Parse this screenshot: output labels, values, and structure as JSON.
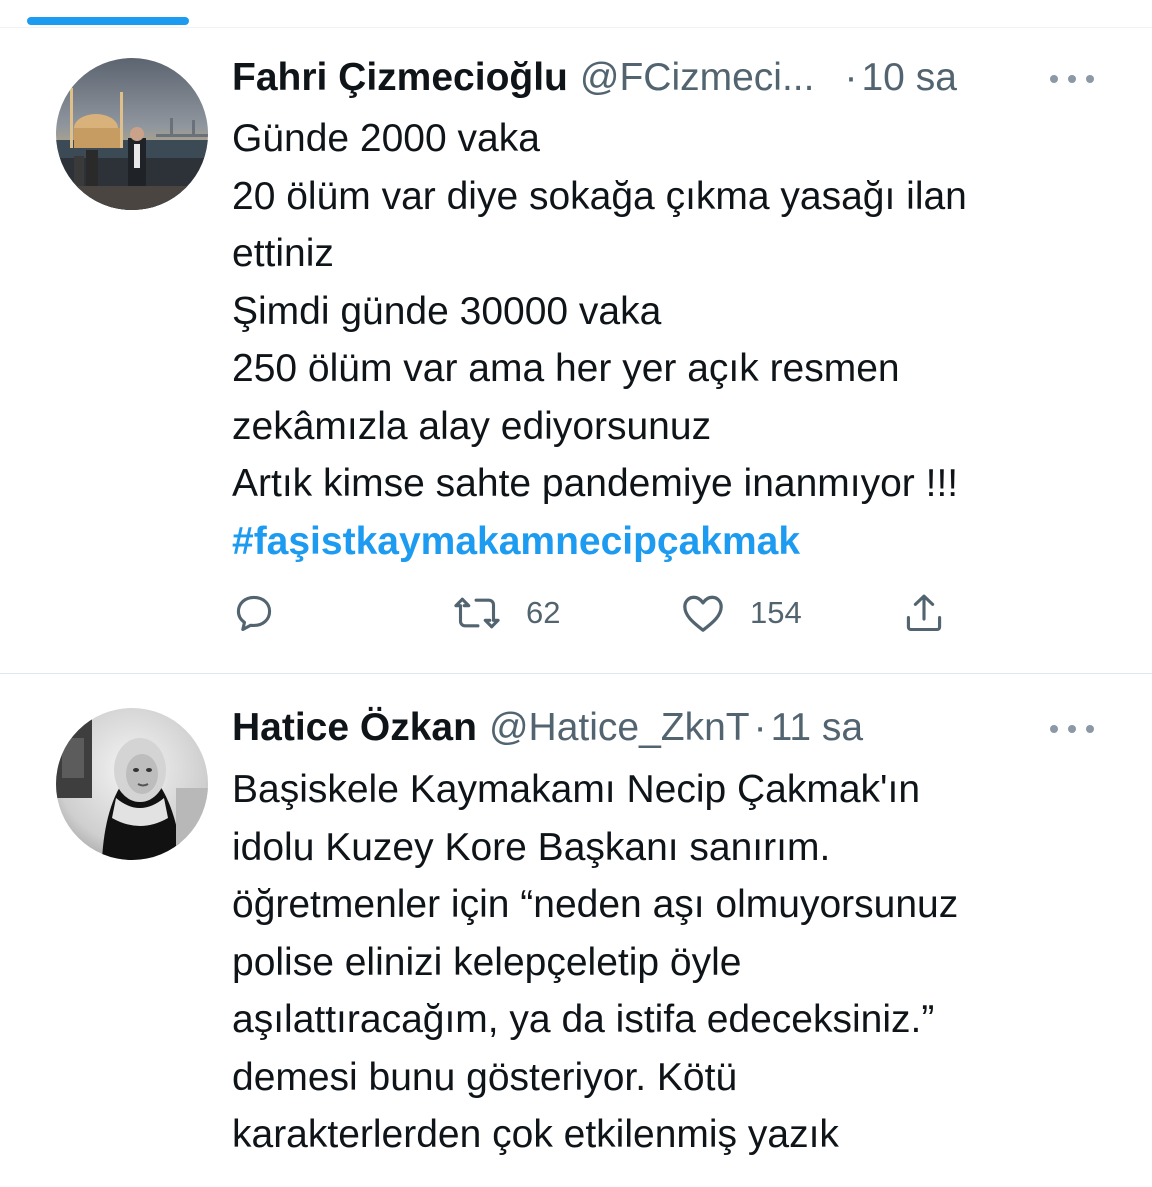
{
  "tweets": [
    {
      "display_name": "Fahri Çizmecioğlu",
      "handle": "@FCizmeci...",
      "separator": "·",
      "time": "10 sa",
      "lines": [
        "Günde 2000 vaka",
        "20 ölüm var diye sokağa çıkma yasağı ilan",
        "ettiniz",
        "Şimdi günde 30000 vaka",
        "250 ölüm var ama her yer açık resmen",
        "zekâmızla alay ediyorsunuz",
        "Artık kimse sahte pandemiye inanmıyor !!!"
      ],
      "hashtag": "#faşistkaymakamnecipçakmak",
      "retweets": "62",
      "likes": "154"
    },
    {
      "display_name": "Hatice Özkan",
      "handle": "@Hatice_ZknT",
      "separator": "·",
      "time": "11 sa",
      "lines": [
        "Başiskele Kaymakamı Necip Çakmak'ın",
        "idolu Kuzey Kore Başkanı sanırım.",
        "öğretmenler için “neden aşı olmuyorsunuz",
        "polise elinizi kelepçeletip öyle",
        "aşılattıracağım, ya da istifa edeceksiniz.”",
        "demesi bunu gösteriyor. Kötü",
        "karakterlerden çok etkilenmiş yazık"
      ]
    }
  ],
  "icons": {
    "reply": "reply-icon",
    "retweet": "retweet-icon",
    "like": "like-icon",
    "share": "share-icon",
    "more": "more-options-icon"
  },
  "colors": {
    "accent": "#1d9bf0",
    "text": "#0f1419",
    "secondary": "#536471",
    "divider": "#e1e8ed"
  }
}
